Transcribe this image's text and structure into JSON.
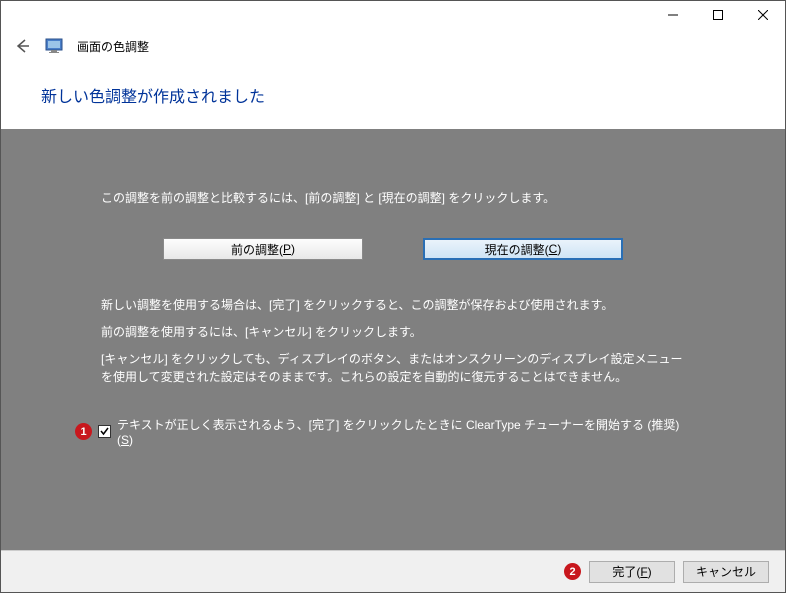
{
  "titlebar": {
    "minimize": "—",
    "maximize": "☐",
    "close": "✕"
  },
  "header": {
    "app_title": "画面の色調整"
  },
  "heading": "新しい色調整が作成されました",
  "content": {
    "instr1": "この調整を前の調整と比較するには、[前の調整] と [現在の調整] をクリックします。",
    "btn_prev_pre": "前の調整(",
    "btn_prev_key": "P",
    "btn_prev_post": ")",
    "btn_curr_pre": "現在の調整(",
    "btn_curr_key": "C",
    "btn_curr_post": ")",
    "instr2": "新しい調整を使用する場合は、[完了] をクリックすると、この調整が保存および使用されます。",
    "instr3": "前の調整を使用するには、[キャンセル] をクリックします。",
    "instr4": "[キャンセル] をクリックしても、ディスプレイのボタン、またはオンスクリーンのディスプレイ設定メニューを使用して変更された設定はそのままです。これらの設定を自動的に復元することはできません。",
    "annot1": "1",
    "check_label_pre": "テキストが正しく表示されるよう、[完了] をクリックしたときに ClearType チューナーを開始する (推奨)(",
    "check_label_key": "S",
    "check_label_post": ")"
  },
  "footer": {
    "annot2": "2",
    "finish_pre": "完了(",
    "finish_key": "F",
    "finish_post": ")",
    "cancel": "キャンセル"
  }
}
